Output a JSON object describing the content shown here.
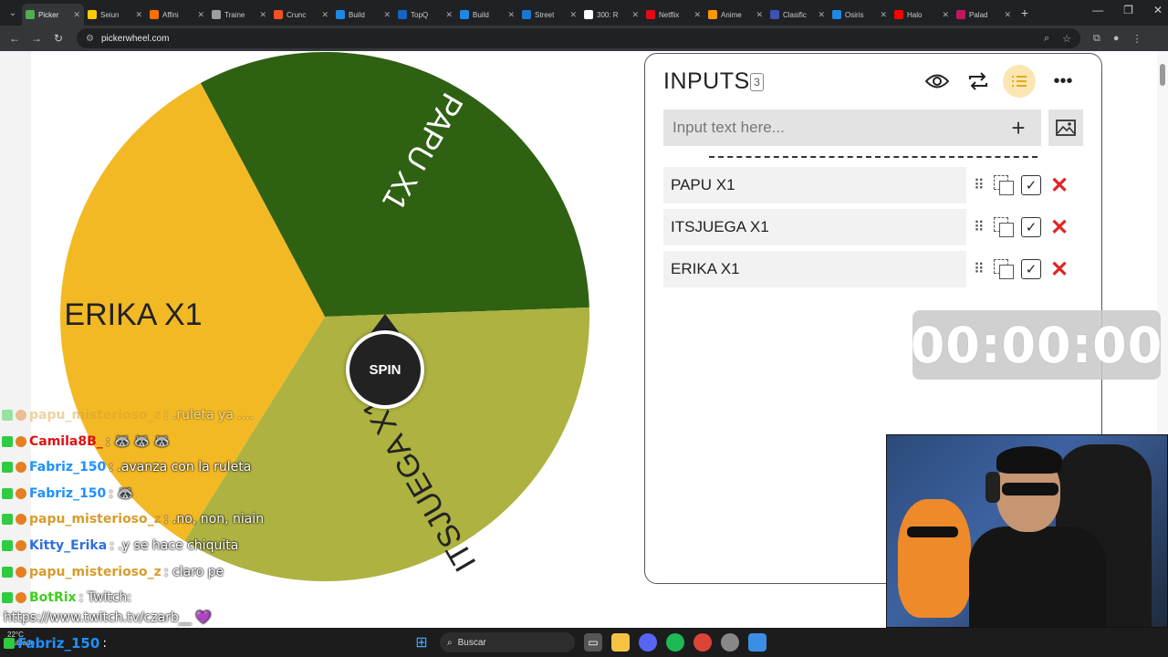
{
  "browser": {
    "tabs": [
      {
        "label": "Picker",
        "color": "#4caf50",
        "active": true
      },
      {
        "label": "Seiun",
        "color": "#ffcc00"
      },
      {
        "label": "Affini",
        "color": "#ff6f00"
      },
      {
        "label": "Traine",
        "color": "#9e9e9e"
      },
      {
        "label": "Crunc",
        "color": "#f4511e"
      },
      {
        "label": "Build",
        "color": "#1e88e5"
      },
      {
        "label": "TopQ",
        "color": "#1565c0"
      },
      {
        "label": "Build",
        "color": "#1e88e5"
      },
      {
        "label": "Street",
        "color": "#1976d2"
      },
      {
        "label": "300: R",
        "color": "#ffffff"
      },
      {
        "label": "Netflix",
        "color": "#e50914"
      },
      {
        "label": "Anime",
        "color": "#ff9800"
      },
      {
        "label": "Clasific",
        "color": "#3f51b5"
      },
      {
        "label": "Osiris",
        "color": "#1e88e5"
      },
      {
        "label": "Halo",
        "color": "#ff0000"
      },
      {
        "label": "Palad",
        "color": "#c2185b"
      }
    ],
    "close_glyph": "✕",
    "new_tab": "+",
    "url": "pickerwheel.com"
  },
  "wheel": {
    "spin_label": "SPIN",
    "segments": [
      {
        "label": "PAPU X1",
        "color": "#2e6112"
      },
      {
        "label": "ITSJUEGA X1",
        "color": "#adb240"
      },
      {
        "label": "ERIKA X1",
        "color": "#f2b925"
      }
    ]
  },
  "inputs_panel": {
    "title": "INPUTS",
    "count": "3",
    "placeholder": "Input text here...",
    "add_glyph": "+",
    "entries": [
      {
        "text": "PAPU X1"
      },
      {
        "text": "ITSJUEGA X1"
      },
      {
        "text": "ERIKA X1"
      }
    ]
  },
  "timer": {
    "text": "00:00:00"
  },
  "chat": {
    "lines": [
      {
        "user": "papu_misterioso_z",
        "msg": ": .ruleta ya ....",
        "color": "#d89c2a",
        "faded": true
      },
      {
        "user": "Camila8B_",
        "msg": ": 🦝 🦝 🦝",
        "color": "#e01010"
      },
      {
        "user": "Fabriz_150",
        "msg": ": .avanza con la ruleta",
        "color": "#1e90ff"
      },
      {
        "user": "Fabriz_150",
        "msg": ": 🦝",
        "color": "#1e90ff"
      },
      {
        "user": "papu_misterioso_z",
        "msg": ": .no, non, niain",
        "color": "#d89c2a"
      },
      {
        "user": "Kitty_Erika",
        "msg": ": .y se hace chiquita",
        "color": "#2f6fde"
      },
      {
        "user": "papu_misterioso_z",
        "msg": ": claro pe",
        "color": "#d89c2a"
      },
      {
        "user": "BotRix",
        "msg": ": Twitch:",
        "color": "#3ecf1e"
      }
    ],
    "link": "https://www.twitch.tv/czarb__ 💜",
    "last_user": "Fabriz_150",
    "last_msg": ":"
  },
  "taskbar": {
    "search_label": "Buscar",
    "weather": "22°C Nublado"
  }
}
